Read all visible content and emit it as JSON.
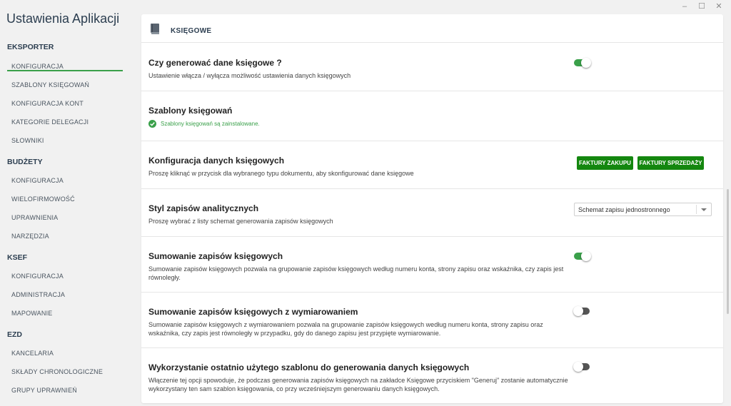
{
  "window": {
    "minimize": "–",
    "maximize": "☐",
    "close": "✕"
  },
  "sidebar": {
    "title": "Ustawienia Aplikacji",
    "sections": [
      {
        "label": "EKSPORTER",
        "items": [
          "KONFIGURACJA",
          "SZABLONY KSIĘGOWAŃ",
          "KONFIGURACJA KONT",
          "KATEGORIE DELEGACJI",
          "SŁOWNIKI"
        ]
      },
      {
        "label": "BUDŻETY",
        "items": [
          "KONFIGURACJA",
          "WIELOFIRMOWOŚĆ",
          "UPRAWNIENIA",
          "NARZĘDZIA"
        ]
      },
      {
        "label": "KSEF",
        "items": [
          "KONFIGURACJA",
          "ADMINISTRACJA",
          "MAPOWANIE"
        ]
      },
      {
        "label": "EZD",
        "items": [
          "KANCELARIA",
          "SKŁADY CHRONOLOGICZNE",
          "GRUPY UPRAWNIEŃ"
        ]
      }
    ],
    "active_item": "KONFIGURACJA",
    "accent_color": "#3aa04a"
  },
  "card": {
    "header_icon": "book-icon",
    "title": "KSIĘGOWE"
  },
  "settings": {
    "generate": {
      "title": "Czy generować dane księgowe ?",
      "desc": "Ustawienie włącza / wyłącza możliwość ustawienia danych księgowych",
      "enabled": true
    },
    "templates": {
      "title": "Szablony księgowań",
      "status_icon": "check-circle-icon",
      "status": "Szablony księgowań są zainstalowane."
    },
    "config": {
      "title": "Konfiguracja danych księgowych",
      "desc": "Proszę kliknąć w przycisk dla wybranego typu dokumentu, aby skonfigurować dane księgowe",
      "btn_purchase": "FAKTURY ZAKUPU",
      "btn_sales": "FAKTURY SPRZEDAŻY"
    },
    "style": {
      "title": "Styl zapisów analitycznych",
      "desc": "Proszę wybrać z listy schemat generowania zapisów księgowych",
      "selected": "Schemat zapisu jednostronnego"
    },
    "summing": {
      "title": "Sumowanie zapisów księgowych",
      "desc": "Sumowanie zapisów księgowych pozwala na grupowanie zapisów księgowych według numeru konta, strony zapisu oraz wskaźnika, czy zapis jest równoległy.",
      "enabled": true
    },
    "summing_dims": {
      "title": "Sumowanie zapisów księgowych z wymiarowaniem",
      "desc": "Sumowanie zapisów księgowych z wymiarowaniem pozwala na grupowanie zapisów księgowych według numeru konta, strony zapisu oraz wskaźnika, czy zapis jest równoległy w przypadku, gdy do danego zapisu jest przypięte wymiarowanie.",
      "enabled": false
    },
    "last_template": {
      "title": "Wykorzystanie ostatnio użytego szablonu do generowania danych księgowych",
      "desc": "Włączenie tej opcji spowoduje, że podczas generowania zapisów księgowych na zakładce Księgowe przyciskiem \"Generuj\" zostanie automatycznie wykorzystany ten sam szablon księgowania, co przy wcześniejszym generowaniu danych księgowych.",
      "enabled": false
    }
  }
}
